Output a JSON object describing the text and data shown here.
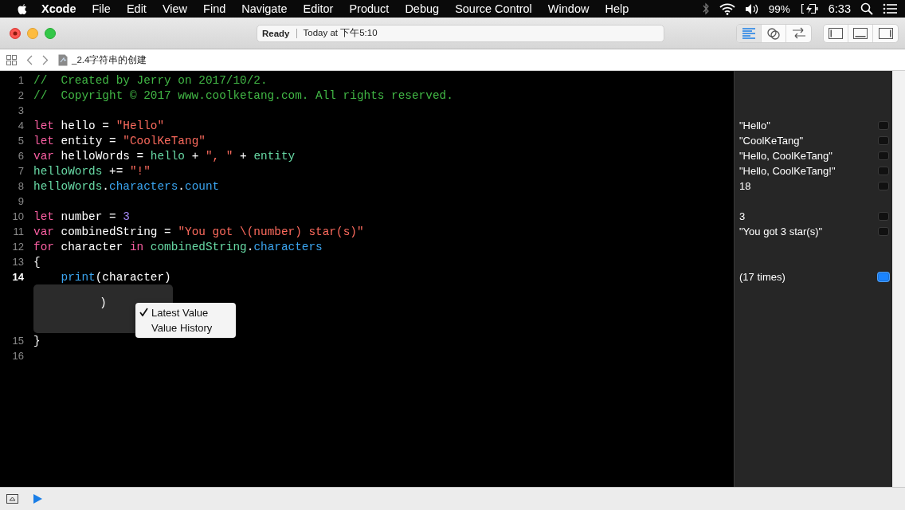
{
  "menubar": {
    "app": "Xcode",
    "menus": [
      "File",
      "Edit",
      "View",
      "Find",
      "Navigate",
      "Editor",
      "Product",
      "Debug",
      "Source Control",
      "Window",
      "Help"
    ],
    "battery": "99%",
    "clock": "6:33"
  },
  "toolbar": {
    "status": "Ready",
    "timestamp": "Today at 下午5:10",
    "editor_modes": [
      {
        "kind": "standard",
        "selected": true
      },
      {
        "kind": "assistant",
        "selected": false
      },
      {
        "kind": "version",
        "selected": false
      }
    ],
    "panels": [
      {
        "kind": "navigator",
        "on": false
      },
      {
        "kind": "debug",
        "on": false
      },
      {
        "kind": "utilities",
        "on": false
      }
    ]
  },
  "jump_bar": {
    "file": "_2.4字符串的创建"
  },
  "editor": {
    "lines": [
      {
        "number": "1",
        "current": false,
        "tokens": [
          {
            "kind": "comment",
            "t": "//  Created by Jerry on 2017/10/2."
          }
        ]
      },
      {
        "number": "2",
        "current": false,
        "tokens": [
          {
            "kind": "comment",
            "t": "//  Copyright © 2017 www.coolketang.com. All rights reserved."
          }
        ]
      },
      {
        "number": "3",
        "current": false
      },
      {
        "number": "4",
        "current": false,
        "tokens": [
          {
            "kind": "keyword",
            "t": "let"
          },
          {
            "kind": "plain",
            "t": " hello = "
          },
          {
            "kind": "string",
            "t": "\"Hello\""
          }
        ],
        "result": {
          "text": "\"Hello\"",
          "selected": false
        }
      },
      {
        "number": "5",
        "current": false,
        "tokens": [
          {
            "kind": "keyword",
            "t": "let"
          },
          {
            "kind": "plain",
            "t": " entity = "
          },
          {
            "kind": "string",
            "t": "\"CoolKeTang\""
          }
        ],
        "result": {
          "text": "\"CoolKeTang\"",
          "selected": false
        }
      },
      {
        "number": "6",
        "current": false,
        "tokens": [
          {
            "kind": "keyword",
            "t": "var"
          },
          {
            "kind": "plain",
            "t": " helloWords = "
          },
          {
            "kind": "identifier",
            "t": "hello"
          },
          {
            "kind": "plain",
            "t": " + "
          },
          {
            "kind": "string",
            "t": "\", \""
          },
          {
            "kind": "plain",
            "t": " + "
          },
          {
            "kind": "identifier",
            "t": "entity"
          }
        ],
        "result": {
          "text": "\"Hello, CoolKeTang\"",
          "selected": false
        }
      },
      {
        "number": "7",
        "current": false,
        "tokens": [
          {
            "kind": "identifier",
            "t": "helloWords"
          },
          {
            "kind": "plain",
            "t": " += "
          },
          {
            "kind": "string",
            "t": "\"!\""
          }
        ],
        "result": {
          "text": "\"Hello, CoolKeTang!\"",
          "selected": false
        }
      },
      {
        "number": "8",
        "current": false,
        "tokens": [
          {
            "kind": "identifier",
            "t": "helloWords"
          },
          {
            "kind": "plain",
            "t": "."
          },
          {
            "kind": "member",
            "t": "characters"
          },
          {
            "kind": "plain",
            "t": "."
          },
          {
            "kind": "member",
            "t": "count"
          }
        ],
        "result": {
          "text": "18",
          "selected": false
        }
      },
      {
        "number": "9",
        "current": false
      },
      {
        "number": "10",
        "current": false,
        "tokens": [
          {
            "kind": "keyword",
            "t": "let"
          },
          {
            "kind": "plain",
            "t": " number = "
          },
          {
            "kind": "number",
            "t": "3"
          }
        ],
        "result": {
          "text": "3",
          "selected": false
        }
      },
      {
        "number": "11",
        "current": false,
        "tokens": [
          {
            "kind": "keyword",
            "t": "var"
          },
          {
            "kind": "plain",
            "t": " combinedString = "
          },
          {
            "kind": "string",
            "t": "\"You got \\(number) star(s)\""
          }
        ],
        "result": {
          "text": "\"You got 3 star(s)\"",
          "selected": false
        }
      },
      {
        "number": "12",
        "current": false,
        "tokens": [
          {
            "kind": "keyword",
            "t": "for"
          },
          {
            "kind": "plain",
            "t": " character "
          },
          {
            "kind": "keyword",
            "t": "in"
          },
          {
            "kind": "identifier",
            "t": " combinedString"
          },
          {
            "kind": "plain",
            "t": "."
          },
          {
            "kind": "member",
            "t": "characters"
          }
        ]
      },
      {
        "number": "13",
        "current": false,
        "tokens": [
          {
            "kind": "plain",
            "t": "{"
          }
        ]
      },
      {
        "number": "14",
        "current": true,
        "tokens": [
          {
            "kind": "member",
            "t": "    print"
          },
          {
            "kind": "plain",
            "t": "(character)"
          }
        ],
        "result": {
          "text": "(17 times)",
          "selected": true
        },
        "inline_result": {
          "value": ")",
          "menu": [
            {
              "label": "Latest Value",
              "checked": true
            },
            {
              "label": "Value History",
              "checked": false
            }
          ]
        }
      },
      {
        "number": "15",
        "current": false,
        "tokens": [
          {
            "kind": "plain",
            "t": "}"
          }
        ]
      },
      {
        "number": "16",
        "current": false
      }
    ]
  },
  "debug_bar": {
    "running": false
  }
}
